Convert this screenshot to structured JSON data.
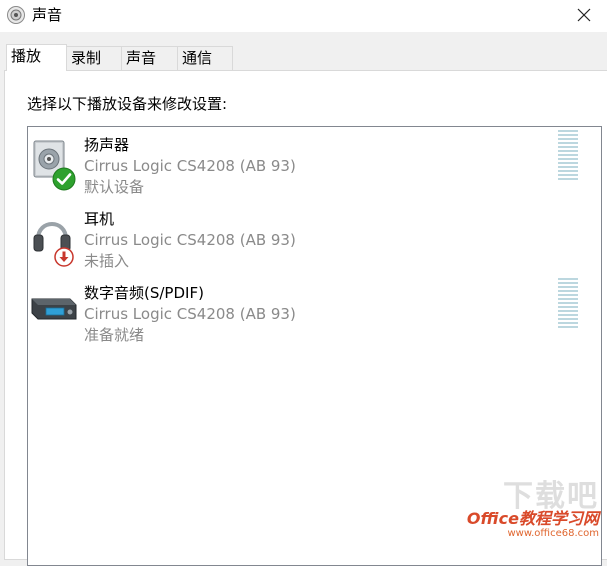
{
  "window": {
    "title": "声音"
  },
  "tabs": [
    {
      "label": "播放",
      "active": true
    },
    {
      "label": "录制",
      "active": false
    },
    {
      "label": "声音",
      "active": false
    },
    {
      "label": "通信",
      "active": false
    }
  ],
  "instruction": "选择以下播放设备来修改设置:",
  "devices": [
    {
      "name": "扬声器",
      "driver": "Cirrus Logic CS4208 (AB 93)",
      "status": "默认设备",
      "icon": "speaker-icon",
      "badge": "default-check-icon"
    },
    {
      "name": "耳机",
      "driver": "Cirrus Logic CS4208 (AB 93)",
      "status": "未插入",
      "icon": "headphones-icon",
      "badge": "unplugged-arrow-icon"
    },
    {
      "name": "数字音频(S/PDIF)",
      "driver": "Cirrus Logic CS4208 (AB 93)",
      "status": "准备就绪",
      "icon": "digital-audio-icon",
      "badge": ""
    }
  ],
  "watermark": {
    "big": "下载吧",
    "brand": "Office教程学习网",
    "url": "www.office68.com"
  },
  "colors": {
    "accent_check": "#2ea12e",
    "badge_red": "#c8372d",
    "meter": "#bcd7df",
    "secondary_text": "#8a8a8a"
  }
}
